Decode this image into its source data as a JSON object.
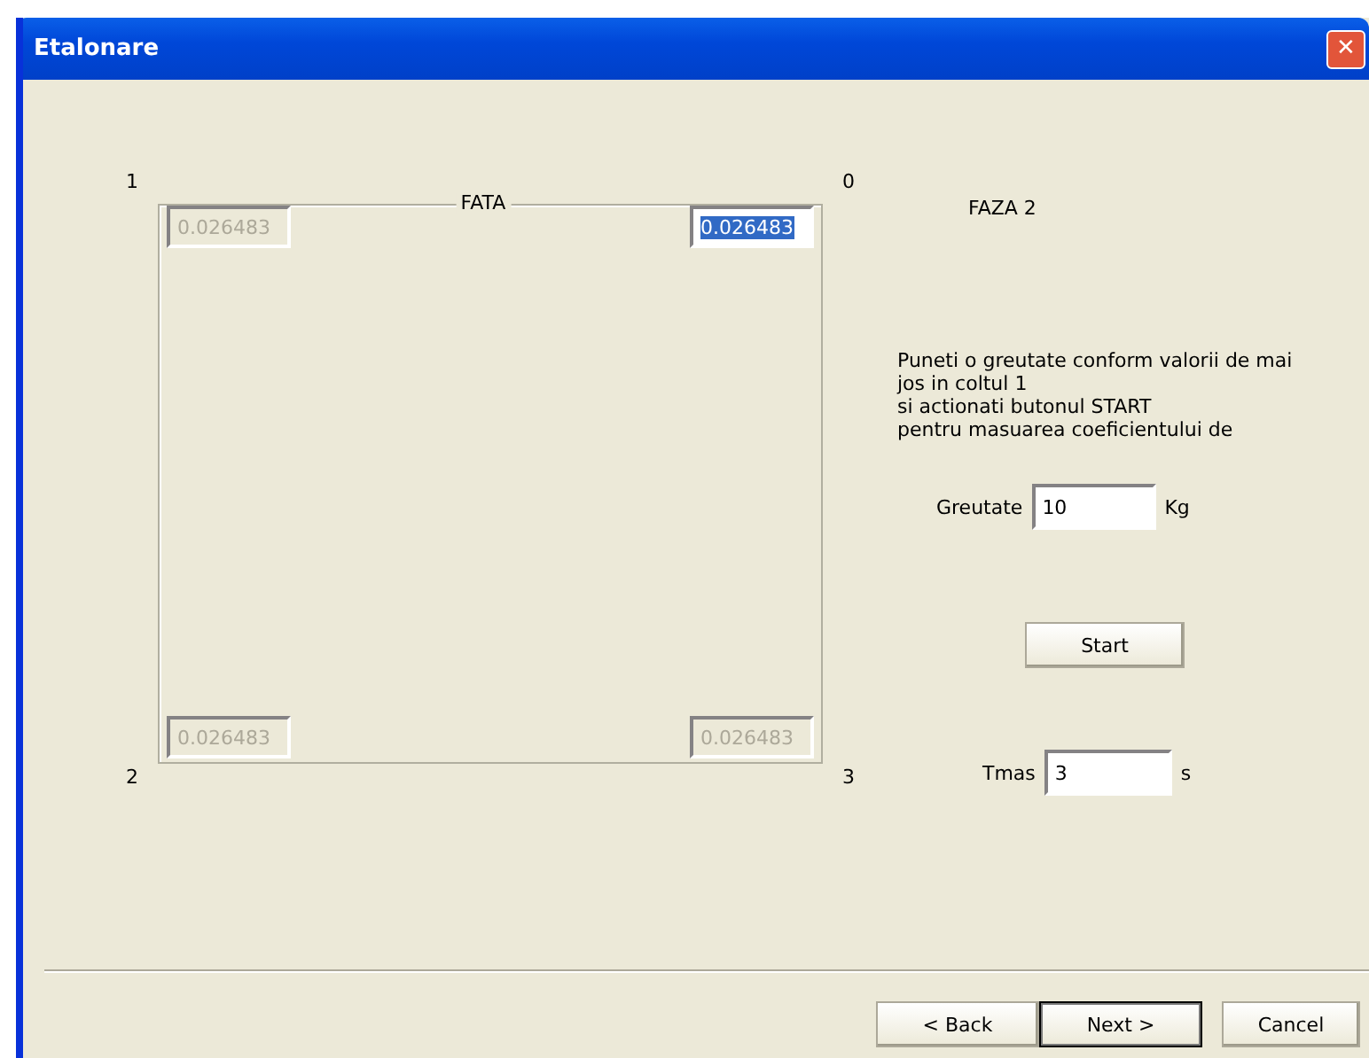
{
  "window": {
    "title": "Etalonare",
    "close": "✕"
  },
  "frame": {
    "legend": "FATA",
    "corner_labels": [
      "1",
      "0",
      "2",
      "3"
    ],
    "corners": [
      {
        "value": "0.026483",
        "disabled": true,
        "selected": false
      },
      {
        "value": "0.026483",
        "disabled": false,
        "selected": true
      },
      {
        "value": "0.026483",
        "disabled": true,
        "selected": false
      },
      {
        "value": "0.026483",
        "disabled": true,
        "selected": false
      }
    ]
  },
  "phase": "FAZA 2",
  "instructions": [
    "Puneti o greutate conform valorii de mai",
    "jos in coltul 1",
    "si actionati butonul START",
    "pentru masuarea coeficientului de"
  ],
  "weight": {
    "label": "Greutate",
    "value": "10",
    "unit": "Kg"
  },
  "start_button": "Start",
  "time": {
    "label": "Tmas",
    "value": "3",
    "unit": "s"
  },
  "buttons": [
    {
      "label": "< Back",
      "default": false
    },
    {
      "label": "Next >",
      "default": true
    },
    {
      "label": "Cancel",
      "default": false
    }
  ]
}
